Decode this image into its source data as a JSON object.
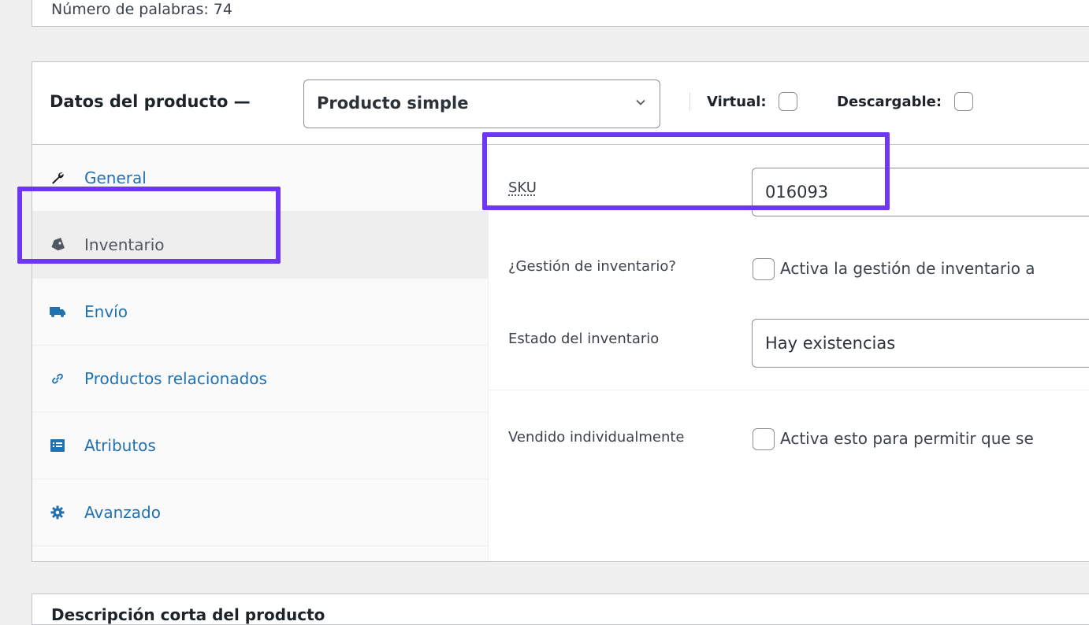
{
  "top_box": {
    "word_count": "Número de palabras: 74"
  },
  "product_data": {
    "title": "Datos del producto —",
    "type_select_value": "Producto simple",
    "virtual_label": "Virtual:",
    "downloadable_label": "Descargable:"
  },
  "tabs": [
    {
      "label": "General",
      "icon": "wrench-icon"
    },
    {
      "label": "Inventario",
      "icon": "tag-icon",
      "active": true
    },
    {
      "label": "Envío",
      "icon": "truck-icon"
    },
    {
      "label": "Productos relacionados",
      "icon": "link-icon"
    },
    {
      "label": "Atributos",
      "icon": "list-icon"
    },
    {
      "label": "Avanzado",
      "icon": "gear-icon"
    }
  ],
  "inventory": {
    "sku_label": "SKU",
    "sku_value": "016093",
    "manage_stock_label": "¿Gestión de inventario?",
    "manage_stock_desc": "Activa la gestión de inventario a",
    "stock_status_label": "Estado del inventario",
    "stock_status_value": "Hay existencias",
    "sold_individually_label": "Vendido individualmente",
    "sold_individually_desc": "Activa esto para permitir que se"
  },
  "bottom_box": {
    "title": "Descripción corta del producto"
  },
  "colors": {
    "highlight": "#6e37f5",
    "link": "#2271b1"
  }
}
